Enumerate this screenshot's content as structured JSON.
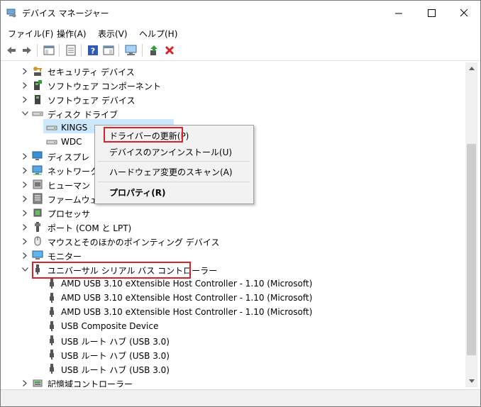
{
  "window": {
    "title": "デバイス マネージャー",
    "controls": {
      "minimize": "—",
      "maximize": "☐",
      "close": "✕"
    }
  },
  "menu": [
    "ファイル(F)",
    "操作(A)",
    "表示(V)",
    "ヘルプ(H)"
  ],
  "toolbar_icons": [
    "back-arrow-icon",
    "forward-arrow-icon",
    "console-tree-icon",
    "properties-icon",
    "help-icon",
    "action-pane-icon",
    "scan-hardware-icon",
    "update-driver-icon",
    "uninstall-icon"
  ],
  "tree": [
    {
      "label": "セキュリティ デバイス",
      "expander": "collapsed",
      "icon": "security-key-icon"
    },
    {
      "label": "ソフトウェア コンポーネント",
      "expander": "collapsed",
      "icon": "software-component-icon"
    },
    {
      "label": "ソフトウェア デバイス",
      "expander": "collapsed",
      "icon": "software-device-icon"
    },
    {
      "label": "ディスク ドライブ",
      "expander": "expanded",
      "icon": "disk-drive-icon"
    },
    {
      "label": "KINGS",
      "expander": "none",
      "icon": "disk-drive-icon",
      "child": true,
      "selected": true
    },
    {
      "label": "WDC",
      "expander": "none",
      "icon": "disk-drive-icon",
      "child": true
    },
    {
      "label": "ディスプレ",
      "expander": "collapsed",
      "icon": "display-adapter-icon"
    },
    {
      "label": "ネットワーク",
      "expander": "collapsed",
      "icon": "network-adapter-icon"
    },
    {
      "label": "ヒューマン",
      "expander": "collapsed",
      "icon": "hid-icon"
    },
    {
      "label": "ファームウェ",
      "expander": "collapsed",
      "icon": "firmware-icon"
    },
    {
      "label": "プロセッサ",
      "expander": "collapsed",
      "icon": "processor-icon"
    },
    {
      "label": "ポート (COM と LPT)",
      "expander": "collapsed",
      "icon": "port-icon"
    },
    {
      "label": "マウスとそのほかのポインティング デバイス",
      "expander": "collapsed",
      "icon": "mouse-icon"
    },
    {
      "label": "モニター",
      "expander": "collapsed",
      "icon": "monitor-icon"
    },
    {
      "label": "ユニバーサル シリアル バス コントローラー",
      "expander": "expanded",
      "icon": "usb-icon",
      "highlighted": true
    },
    {
      "label": "AMD USB 3.10 eXtensible Host Controller - 1.10 (Microsoft)",
      "expander": "none",
      "icon": "usb-icon",
      "child": true
    },
    {
      "label": "AMD USB 3.10 eXtensible Host Controller - 1.10 (Microsoft)",
      "expander": "none",
      "icon": "usb-icon",
      "child": true
    },
    {
      "label": "AMD USB 3.10 eXtensible Host Controller - 1.10 (Microsoft)",
      "expander": "none",
      "icon": "usb-icon",
      "child": true
    },
    {
      "label": "USB Composite Device",
      "expander": "none",
      "icon": "usb-icon",
      "child": true
    },
    {
      "label": "USB ルート ハブ (USB 3.0)",
      "expander": "none",
      "icon": "usb-icon",
      "child": true
    },
    {
      "label": "USB ルート ハブ (USB 3.0)",
      "expander": "none",
      "icon": "usb-icon",
      "child": true
    },
    {
      "label": "USB ルート ハブ (USB 3.0)",
      "expander": "none",
      "icon": "usb-icon",
      "child": true
    },
    {
      "label": "記憶域コントローラー",
      "expander": "collapsed",
      "icon": "storage-controller-icon"
    }
  ],
  "context_menu": {
    "items": [
      "ドライバーの更新(P)",
      "デバイスのアンインストール(U)",
      "ハードウェア変更のスキャン(A)",
      "プロパティ(R)"
    ],
    "highlighted_item": "ドライバーの更新(P)"
  },
  "colors": {
    "highlight_red": "#d9232a",
    "selection": "#cce8ff",
    "usb_icon": "#555555"
  }
}
